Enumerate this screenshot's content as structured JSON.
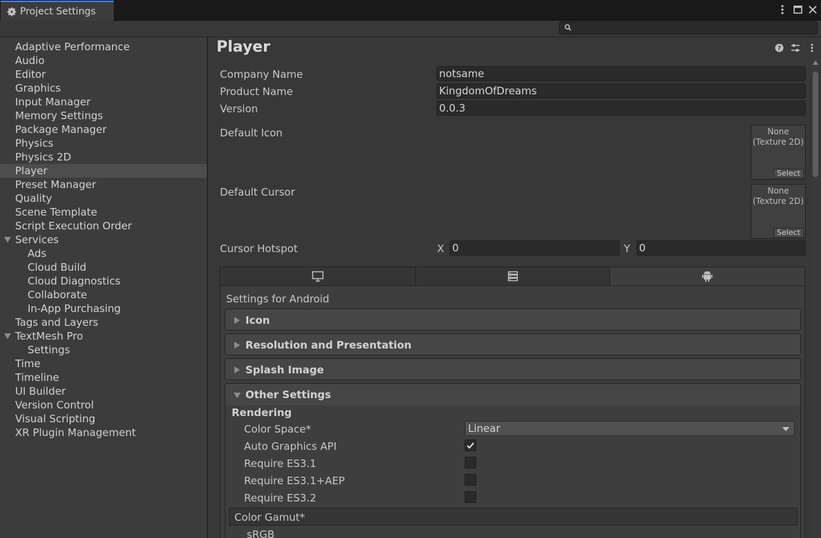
{
  "window": {
    "tab_title": "Project Settings",
    "controls": [
      "more-icon",
      "maximize-icon",
      "close-icon"
    ]
  },
  "search": {
    "placeholder": ""
  },
  "sidebar": {
    "items": [
      {
        "label": "Adaptive Performance"
      },
      {
        "label": "Audio"
      },
      {
        "label": "Editor"
      },
      {
        "label": "Graphics"
      },
      {
        "label": "Input Manager"
      },
      {
        "label": "Memory Settings"
      },
      {
        "label": "Package Manager"
      },
      {
        "label": "Physics"
      },
      {
        "label": "Physics 2D"
      },
      {
        "label": "Player",
        "selected": true
      },
      {
        "label": "Preset Manager"
      },
      {
        "label": "Quality"
      },
      {
        "label": "Scene Template"
      },
      {
        "label": "Script Execution Order"
      },
      {
        "label": "Services",
        "expanded": true
      },
      {
        "label": "Ads"
      },
      {
        "label": "Cloud Build"
      },
      {
        "label": "Cloud Diagnostics"
      },
      {
        "label": "Collaborate"
      },
      {
        "label": "In-App Purchasing"
      },
      {
        "label": "Tags and Layers"
      },
      {
        "label": "TextMesh Pro",
        "expanded": true
      },
      {
        "label": "Settings"
      },
      {
        "label": "Time"
      },
      {
        "label": "Timeline"
      },
      {
        "label": "UI Builder"
      },
      {
        "label": "Version Control"
      },
      {
        "label": "Visual Scripting"
      },
      {
        "label": "XR Plugin Management"
      }
    ]
  },
  "player": {
    "title": "Player",
    "company_name_label": "Company Name",
    "company_name": "notsame",
    "product_name_label": "Product Name",
    "product_name": "KingdomOfDreams",
    "version_label": "Version",
    "version": "0.0.3",
    "default_icon_label": "Default Icon",
    "default_cursor_label": "Default Cursor",
    "texture_none_line1": "None",
    "texture_none_line2": "(Texture 2D)",
    "select_label": "Select",
    "cursor_hotspot_label": "Cursor Hotspot",
    "hotspot_x_label": "X",
    "hotspot_x": "0",
    "hotspot_y_label": "Y",
    "hotspot_y": "0"
  },
  "platform": {
    "tabs": [
      "monitor-icon",
      "server-icon",
      "android-icon"
    ],
    "settings_for": "Settings for Android",
    "sections": [
      {
        "title": "Icon",
        "expanded": false
      },
      {
        "title": "Resolution and Presentation",
        "expanded": false
      },
      {
        "title": "Splash Image",
        "expanded": false
      },
      {
        "title": "Other Settings",
        "expanded": true
      }
    ]
  },
  "other_settings": {
    "rendering_label": "Rendering",
    "color_space_label": "Color Space*",
    "color_space_value": "Linear",
    "auto_graphics_label": "Auto Graphics API",
    "auto_graphics_checked": true,
    "es31_label": "Require ES3.1",
    "es31_checked": false,
    "es31aep_label": "Require ES3.1+AEP",
    "es31aep_checked": false,
    "es32_label": "Require ES3.2",
    "es32_checked": false,
    "color_gamut_label": "Color Gamut*",
    "gamut_first": "sRGB"
  }
}
